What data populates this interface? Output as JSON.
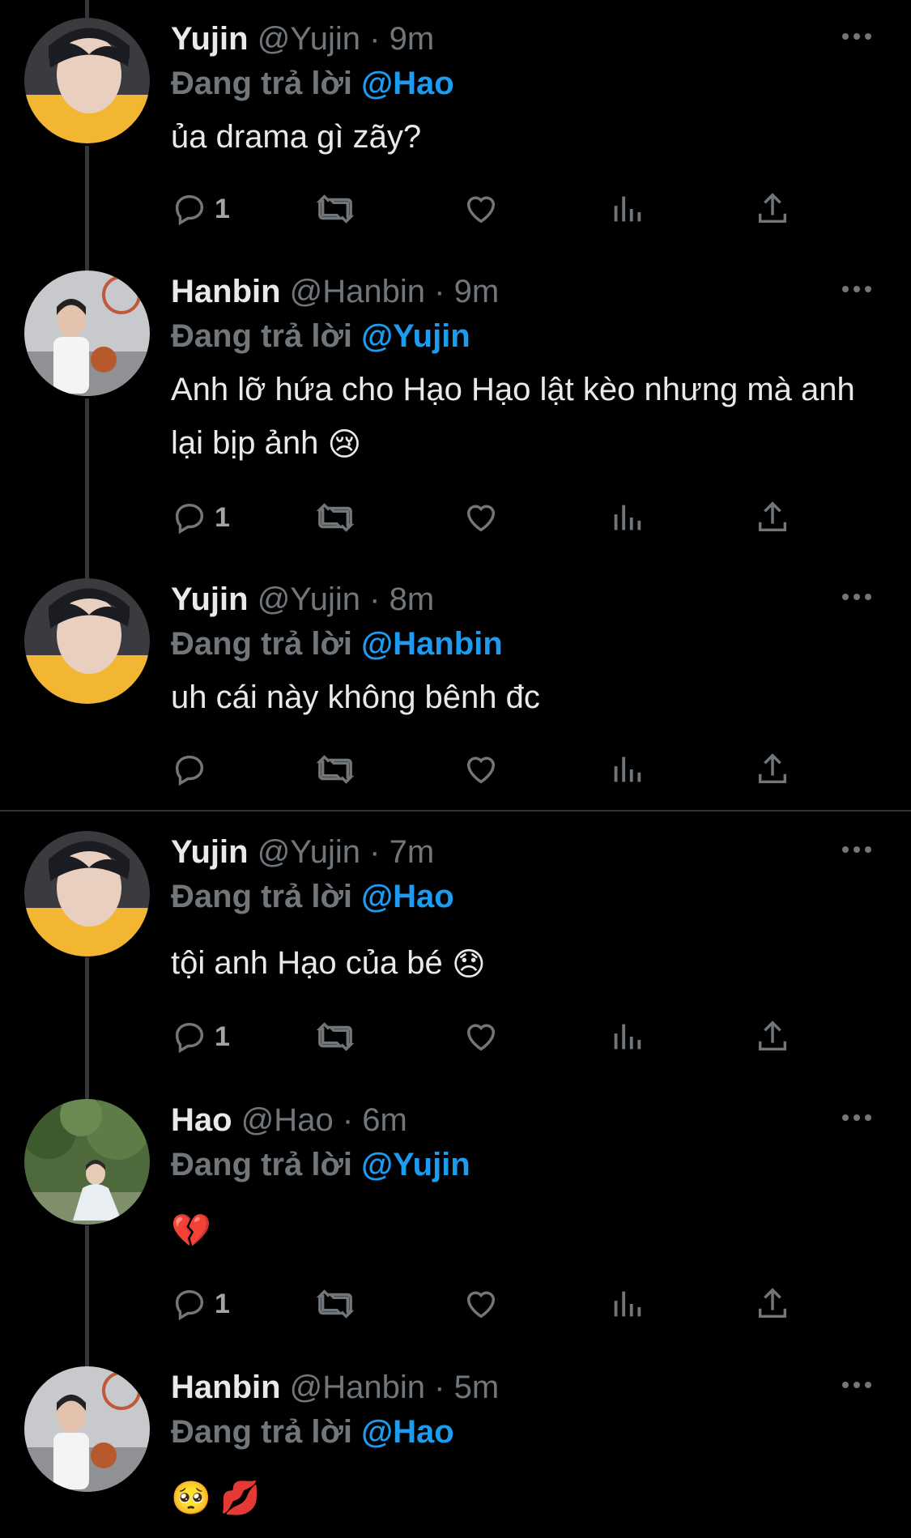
{
  "tweets": [
    {
      "name": "Yujin",
      "handle": "@Yujin",
      "time": "9m",
      "reply_prefix": "Đang trả lời",
      "reply_to": "@Hao",
      "text": "ủa drama gì zãy?",
      "emoji": "",
      "reply_count": "1"
    },
    {
      "name": "Hanbin",
      "handle": "@Hanbin",
      "time": "9m",
      "reply_prefix": "Đang trả lời",
      "reply_to": "@Yujin",
      "text": "Anh lỡ hứa cho Hạo Hạo lật kèo nhưng mà anh lại bịp ảnh",
      "emoji": "😢",
      "reply_count": "1"
    },
    {
      "name": "Yujin",
      "handle": "@Yujin",
      "time": "8m",
      "reply_prefix": "Đang trả lời",
      "reply_to": "@Hanbin",
      "text": "uh cái này không bênh đc",
      "emoji": "",
      "reply_count": ""
    },
    {
      "name": "Yujin",
      "handle": "@Yujin",
      "time": "7m",
      "reply_prefix": "Đang trả lời",
      "reply_to": "@Hao",
      "text": "tội anh Hạo của bé",
      "emoji": "😞",
      "reply_count": "1"
    },
    {
      "name": "Hao",
      "handle": "@Hao",
      "time": "6m",
      "reply_prefix": "Đang trả lời",
      "reply_to": "@Yujin",
      "text": "",
      "emoji": "💔",
      "reply_count": "1"
    },
    {
      "name": "Hanbin",
      "handle": "@Hanbin",
      "time": "5m",
      "reply_prefix": "Đang trả lời",
      "reply_to": "@Hao",
      "text": "",
      "emoji": "🥺 💋",
      "reply_count": ""
    }
  ],
  "separator": "·",
  "colors": {
    "background": "#000000",
    "accent": "#1d9bf0",
    "muted": "#71767b",
    "text": "#e7e9ea"
  },
  "icons": [
    "reply-icon",
    "retweet-icon",
    "like-icon",
    "views-icon",
    "share-icon",
    "more-icon"
  ]
}
